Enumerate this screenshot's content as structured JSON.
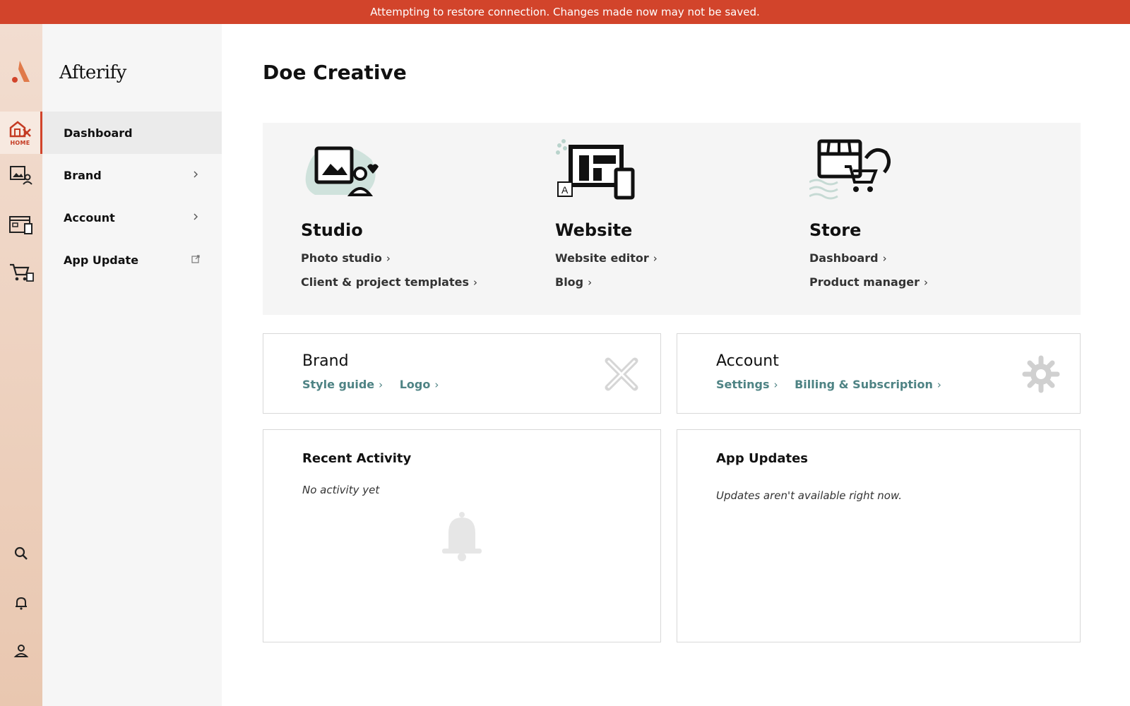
{
  "banner": {
    "text": "Attempting to restore connection. Changes made now may not be saved."
  },
  "rail": {
    "home_label": "HOME"
  },
  "sidebar": {
    "logo_text": "Afterify",
    "items": [
      {
        "label": "Dashboard"
      },
      {
        "label": "Brand"
      },
      {
        "label": "Account"
      },
      {
        "label": "App Update"
      }
    ]
  },
  "page": {
    "title": "Doe Creative"
  },
  "hero": [
    {
      "title": "Studio",
      "links": [
        "Photo studio",
        "Client & project templates"
      ]
    },
    {
      "title": "Website",
      "links": [
        "Website editor",
        "Blog"
      ]
    },
    {
      "title": "Store",
      "links": [
        "Dashboard",
        "Product manager"
      ]
    }
  ],
  "cards": {
    "brand": {
      "title": "Brand",
      "links": [
        "Style guide",
        "Logo"
      ]
    },
    "account": {
      "title": "Account",
      "links": [
        "Settings",
        "Billing & Subscription"
      ]
    },
    "recent": {
      "title": "Recent Activity",
      "empty": "No activity yet"
    },
    "updates": {
      "title": "App Updates",
      "empty": "Updates aren't available right now."
    }
  },
  "colors": {
    "banner": "#d2442b",
    "accent": "#d2442b",
    "link_teal": "#4e8384"
  }
}
